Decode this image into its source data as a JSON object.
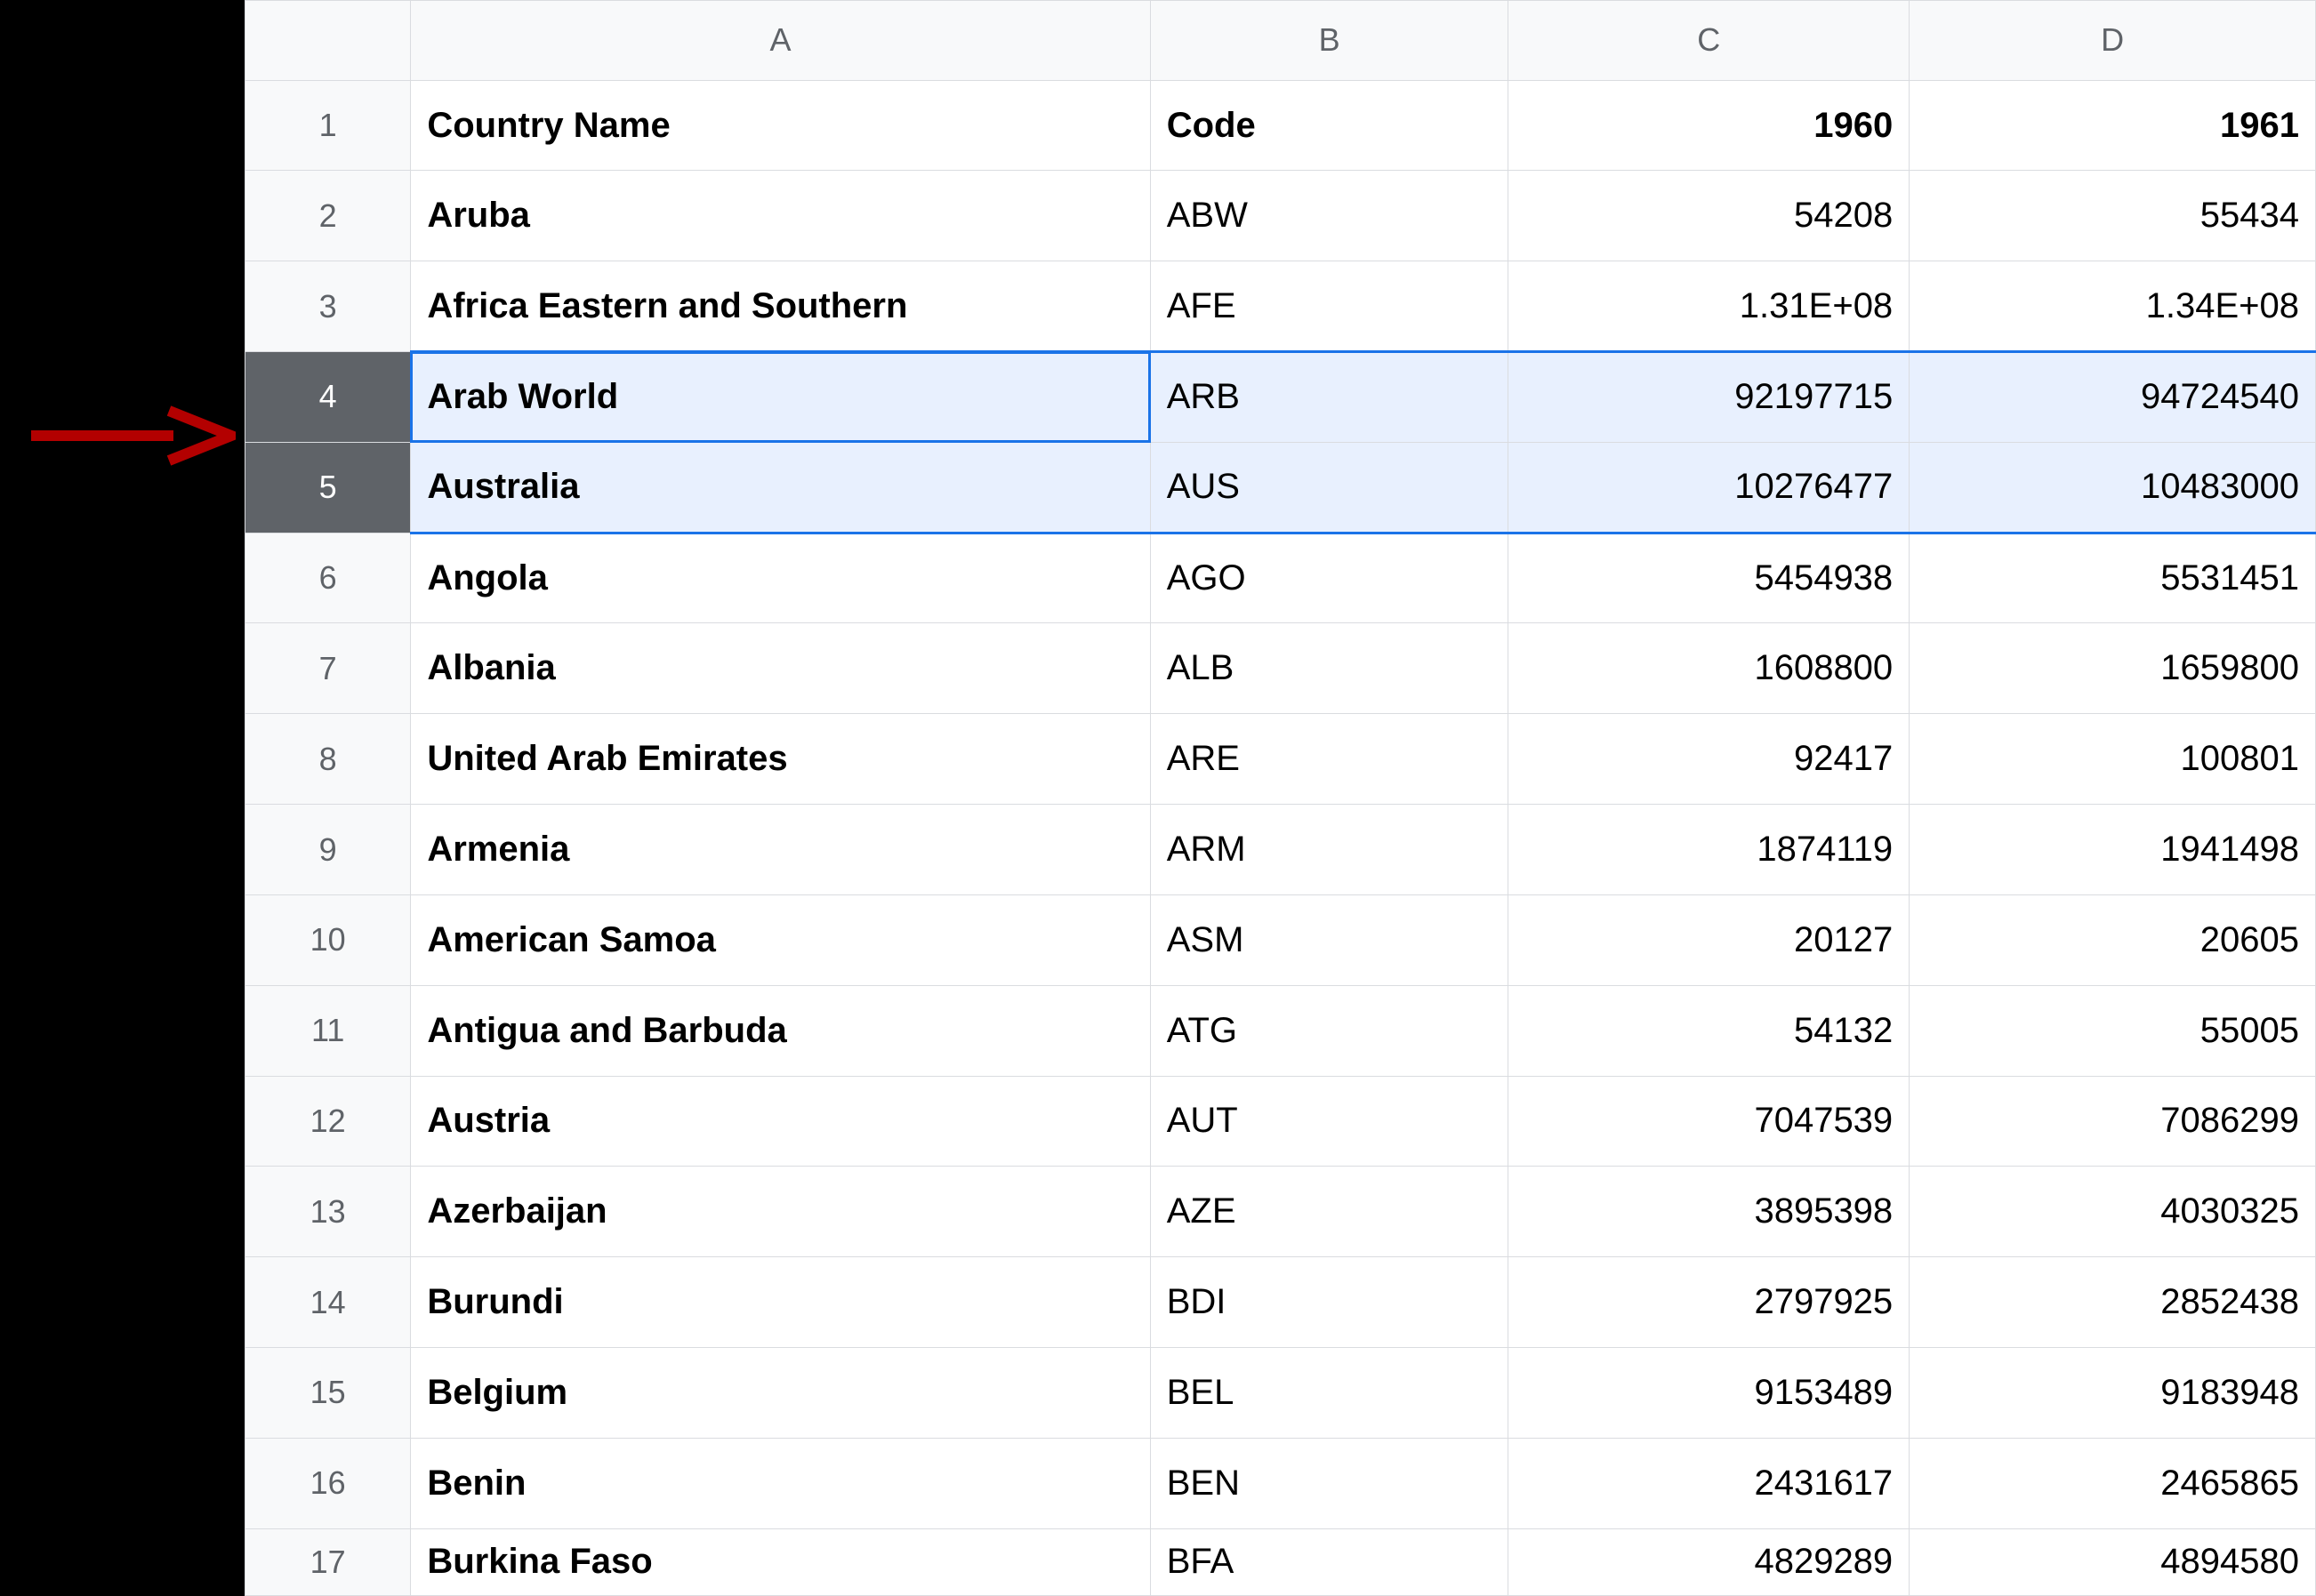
{
  "columns": [
    "A",
    "B",
    "C",
    "D"
  ],
  "row_numbers": [
    "1",
    "2",
    "3",
    "4",
    "5",
    "6",
    "7",
    "8",
    "9",
    "10",
    "11",
    "12",
    "13",
    "14",
    "15",
    "16",
    "17"
  ],
  "header_row": {
    "country": "Country Name",
    "code": "Code",
    "y1": "1960",
    "y2": "1961"
  },
  "rows": [
    {
      "country": "Aruba",
      "code": "ABW",
      "y1": "54208",
      "y2": "55434"
    },
    {
      "country": "Africa Eastern and Southern",
      "code": "AFE",
      "y1": "1.31E+08",
      "y2": "1.34E+08"
    },
    {
      "country": "Arab World",
      "code": "ARB",
      "y1": "92197715",
      "y2": "94724540"
    },
    {
      "country": "Australia",
      "code": "AUS",
      "y1": "10276477",
      "y2": "10483000"
    },
    {
      "country": "Angola",
      "code": "AGO",
      "y1": "5454938",
      "y2": "5531451"
    },
    {
      "country": "Albania",
      "code": "ALB",
      "y1": "1608800",
      "y2": "1659800"
    },
    {
      "country": "United Arab Emirates",
      "code": "ARE",
      "y1": "92417",
      "y2": "100801"
    },
    {
      "country": "Armenia",
      "code": "ARM",
      "y1": "1874119",
      "y2": "1941498"
    },
    {
      "country": "American Samoa",
      "code": "ASM",
      "y1": "20127",
      "y2": "20605"
    },
    {
      "country": "Antigua and Barbuda",
      "code": "ATG",
      "y1": "54132",
      "y2": "55005"
    },
    {
      "country": "Austria",
      "code": "AUT",
      "y1": "7047539",
      "y2": "7086299"
    },
    {
      "country": "Azerbaijan",
      "code": "AZE",
      "y1": "3895398",
      "y2": "4030325"
    },
    {
      "country": "Burundi",
      "code": "BDI",
      "y1": "2797925",
      "y2": "2852438"
    },
    {
      "country": "Belgium",
      "code": "BEL",
      "y1": "9153489",
      "y2": "9183948"
    },
    {
      "country": "Benin",
      "code": "BEN",
      "y1": "2431617",
      "y2": "2465865"
    },
    {
      "country": "Burkina Faso",
      "code": "BFA",
      "y1": "4829289",
      "y2": "4894580"
    }
  ],
  "selected_rows": [
    4,
    5
  ],
  "active_cell": "A4",
  "annotation": {
    "kind": "arrow",
    "color": "#b30000",
    "points_at_row": 4
  }
}
